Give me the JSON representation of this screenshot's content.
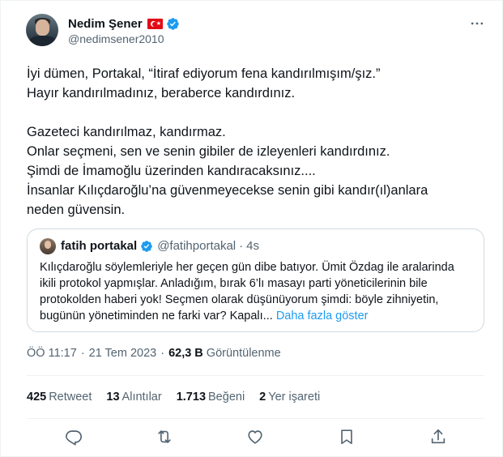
{
  "author": {
    "display_name": "Nedim Şener",
    "handle": "@nedimsener2010"
  },
  "tweet": {
    "lines": [
      "İyi dümen, Portakal, “İtiraf ediyorum fena kandırılmışım/şız.”",
      "Hayır kandırılmadınız, beraberce kandırdınız.",
      "",
      "Gazeteci kandırılmaz, kandırmaz.",
      "Onlar seçmeni, sen ve senin gibiler de izleyenleri kandırdınız.",
      "Şimdi de İmamoğlu üzerinden kandıracaksınız....",
      "İnsanlar Kılıçdaroğlu’na güvenmeyecekse senin gibi kandır(ıl)anlara",
      "neden güvensin."
    ]
  },
  "quoted": {
    "display_name": "fatih portakal",
    "handle": "@fatihportakal",
    "dot": "·",
    "time": "4s",
    "lines": [
      "Kılıçdaroğlu söylemleriyle her geçen gün dibe batıyor. Ümit Özdag ile aralarinda",
      "ikili protokol yapmışlar. Anladığım, bırak 6’lı masayı parti yöneticilerinin bile",
      "protokolden haberi yok! Seçmen olarak düşünüyorum şimdi: böyle zihniyetin,"
    ],
    "last_line": "bugünün yönetiminden ne farki var? Kapalı...",
    "show_more": "Daha fazla göster"
  },
  "meta": {
    "time": "ÖÖ 11:17",
    "dot": "·",
    "date": "21 Tem 2023",
    "views_count": "62,3 B",
    "views_label": "Görüntülenme"
  },
  "stats": {
    "retweets": {
      "num": "425",
      "label": "Retweet"
    },
    "quotes": {
      "num": "13",
      "label": "Alıntılar"
    },
    "likes": {
      "num": "1.713",
      "label": "Beğeni"
    },
    "bookmarks": {
      "num": "2",
      "label": "Yer işareti"
    }
  },
  "icons": {
    "verified": "verified-badge-icon",
    "flag": "turkey-flag-icon",
    "more": "more-options-icon",
    "reply": "reply-icon",
    "retweet": "retweet-icon",
    "like": "like-icon",
    "bookmark": "bookmark-icon",
    "share": "share-icon"
  },
  "colors": {
    "accent": "#1d9bf0",
    "text": "#0f1419",
    "secondary": "#536471",
    "border": "#cfd9de"
  }
}
